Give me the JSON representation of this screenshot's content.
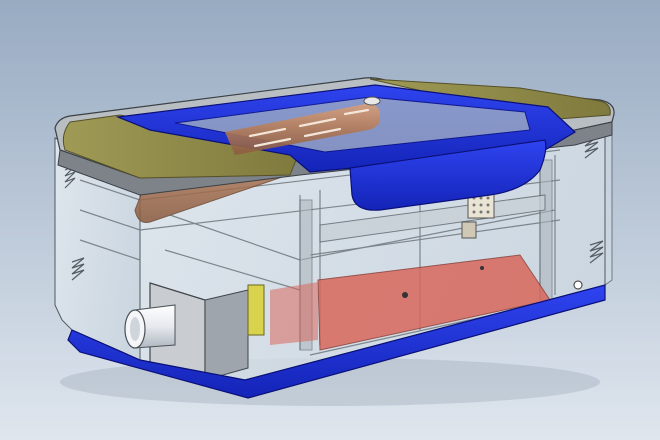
{
  "scene": {
    "subject": "",
    "colors": {
      "background_top": "#98abc2",
      "background_bottom": "#dfe6ee",
      "frame_blue": "#1f2fd6",
      "frame_blue_dark": "#0f1a98",
      "lid_olive": "#8f8a46",
      "case_gray": "#b9bec3",
      "case_gray_dark": "#6f767c",
      "glass": "#d7e2ea",
      "red_panel": "#d9685c",
      "tube_copper": "#b27a57",
      "outline": "#2b2f33"
    }
  }
}
